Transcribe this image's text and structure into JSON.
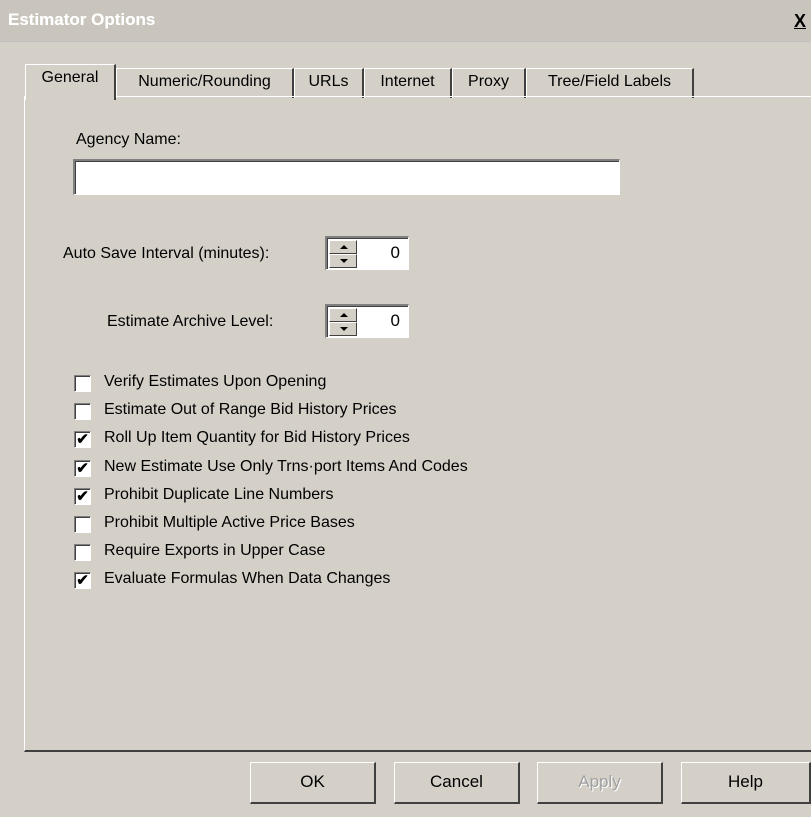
{
  "window": {
    "title": "Estimator Options",
    "close_label": "X"
  },
  "tabs": [
    {
      "label": "General",
      "active": true
    },
    {
      "label": "Numeric/Rounding",
      "active": false
    },
    {
      "label": "URLs",
      "active": false
    },
    {
      "label": "Internet",
      "active": false
    },
    {
      "label": "Proxy",
      "active": false
    },
    {
      "label": "Tree/Field Labels",
      "active": false
    }
  ],
  "general": {
    "agency_name_label": "Agency Name:",
    "agency_name_value": "",
    "auto_save_label": "Auto Save Interval (minutes):",
    "auto_save_value": "0",
    "archive_level_label": "Estimate Archive Level:",
    "archive_level_value": "0"
  },
  "checkboxes": [
    {
      "label": "Verify Estimates Upon Opening",
      "checked": false,
      "mark": ""
    },
    {
      "label": "Estimate Out of Range Bid History Prices",
      "checked": false,
      "mark": ""
    },
    {
      "label": "Roll Up Item Quantity for Bid History Prices",
      "checked": true,
      "mark": "✔"
    },
    {
      "label": "New Estimate Use Only Trns·port Items And Codes",
      "checked": true,
      "mark": "✔"
    },
    {
      "label": "Prohibit Duplicate Line Numbers",
      "checked": true,
      "mark": "✔"
    },
    {
      "label": "Prohibit Multiple Active Price Bases",
      "checked": false,
      "mark": ""
    },
    {
      "label": "Require Exports in Upper Case",
      "checked": false,
      "mark": ""
    },
    {
      "label": "Evaluate Formulas When Data Changes",
      "checked": true,
      "mark": "✔"
    }
  ],
  "buttons": {
    "ok": "OK",
    "cancel": "Cancel",
    "apply": "Apply",
    "help": "Help"
  }
}
